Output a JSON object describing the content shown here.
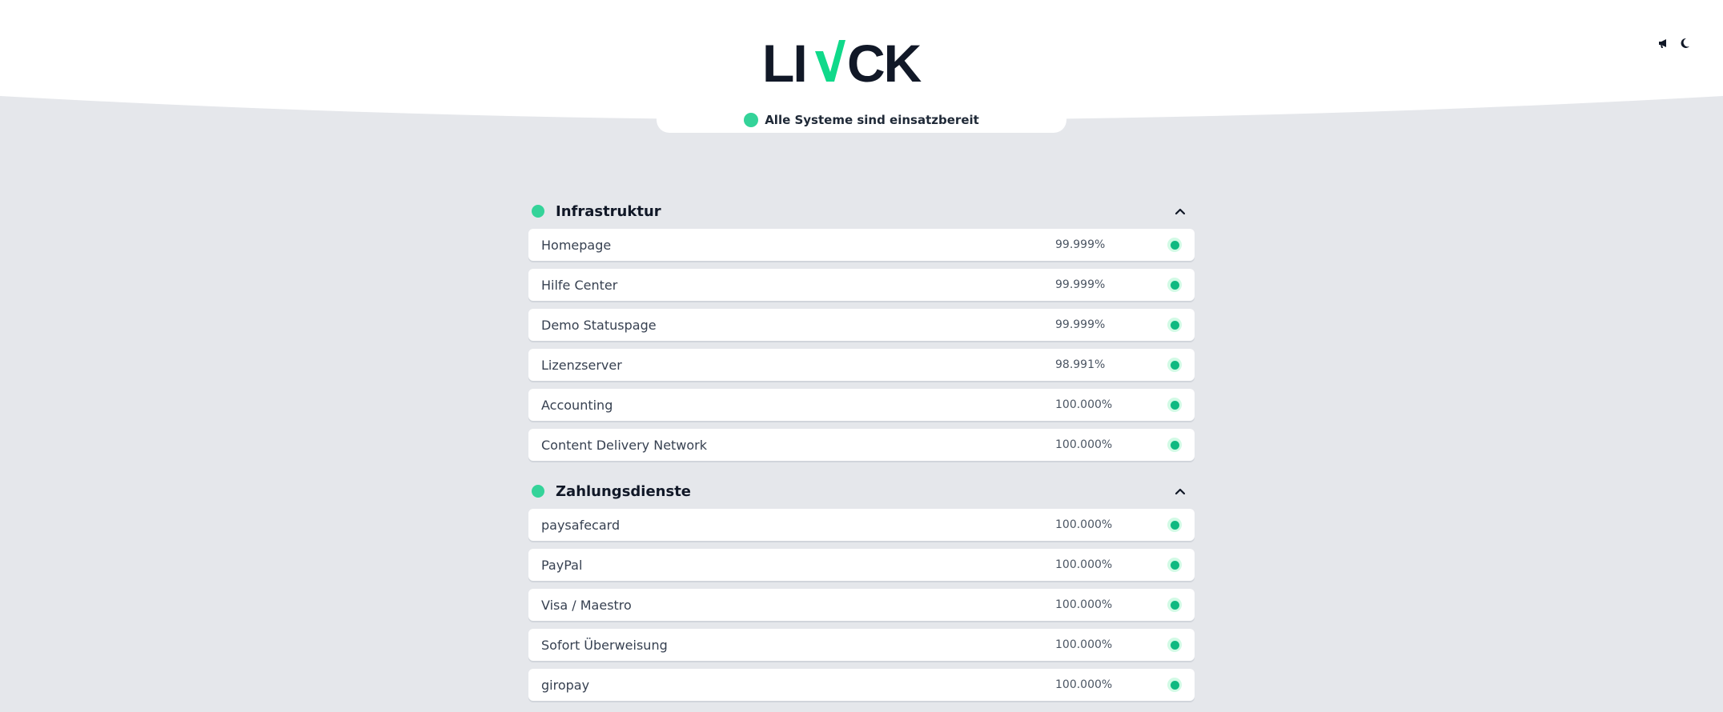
{
  "header": {
    "logo_alt": "LIVCK",
    "status_text": "Alle Systeme sind einsatzbereit",
    "icons": [
      "megaphone-icon",
      "moon-icon"
    ]
  },
  "colors": {
    "operational": "#10b981",
    "operational_light": "#34d399",
    "logo_dark": "#111827",
    "logo_accent": "#10d98a",
    "background": "#e5e7eb"
  },
  "groups": [
    {
      "title": "Infrastruktur",
      "services": [
        {
          "name": "Homepage",
          "uptime": "99.999%"
        },
        {
          "name": "Hilfe Center",
          "uptime": "99.999%"
        },
        {
          "name": "Demo Statuspage",
          "uptime": "99.999%"
        },
        {
          "name": "Lizenzserver",
          "uptime": "98.991%"
        },
        {
          "name": "Accounting",
          "uptime": "100.000%"
        },
        {
          "name": "Content Delivery Network",
          "uptime": "100.000%"
        }
      ]
    },
    {
      "title": "Zahlungsdienste",
      "services": [
        {
          "name": "paysafecard",
          "uptime": "100.000%"
        },
        {
          "name": "PayPal",
          "uptime": "100.000%"
        },
        {
          "name": "Visa / Maestro",
          "uptime": "100.000%"
        },
        {
          "name": "Sofort Überweisung",
          "uptime": "100.000%"
        },
        {
          "name": "giropay",
          "uptime": "100.000%"
        }
      ]
    }
  ]
}
